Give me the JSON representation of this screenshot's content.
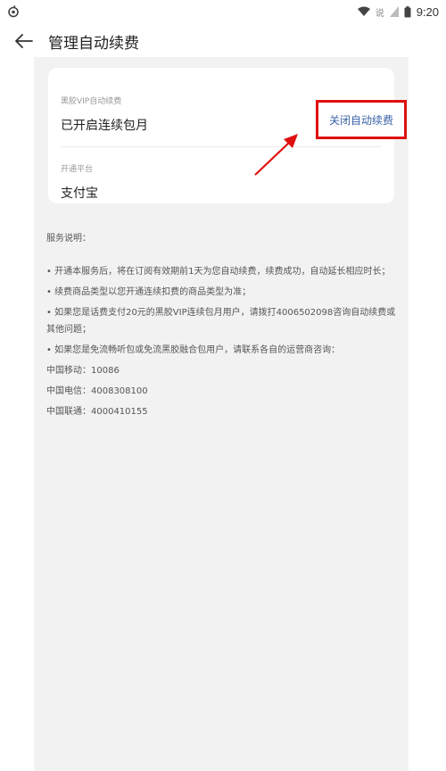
{
  "status_bar": {
    "time": "9:20",
    "icons": [
      "app-notification-icon",
      "wifi-icon",
      "signal-icon",
      "battery-icon"
    ],
    "small_text": "说"
  },
  "header": {
    "title": "管理自动续费",
    "back_icon": "back-arrow-icon"
  },
  "card": {
    "vip_label": "黑胶VIP自动续费",
    "vip_status": "已开启连续包月",
    "cancel_label": "关闭自动续费",
    "platform_label": "开通平台",
    "platform_value": "支付宝"
  },
  "annotation": {
    "highlight_color": "#e01010",
    "arrow_color": "#e01010"
  },
  "notes": {
    "title": "服务说明：",
    "items": [
      "• 开通本服务后，将在订阅有效期前1天为您自动续费，续费成功，自动延长相应时长；",
      "• 续费商品类型以您开通连续扣费的商品类型为准；",
      "• 如果您是话费支付20元的黑胶VIP连续包月用户，请拨打4006502098咨询自动续费或其他问题；",
      "• 如果您是免流畅听包或免流黑胶融合包用户，请联系各自的运营商咨询："
    ],
    "contacts": [
      "中国移动：10086",
      "中国电信：4008308100",
      "中国联通：4000410155"
    ]
  }
}
